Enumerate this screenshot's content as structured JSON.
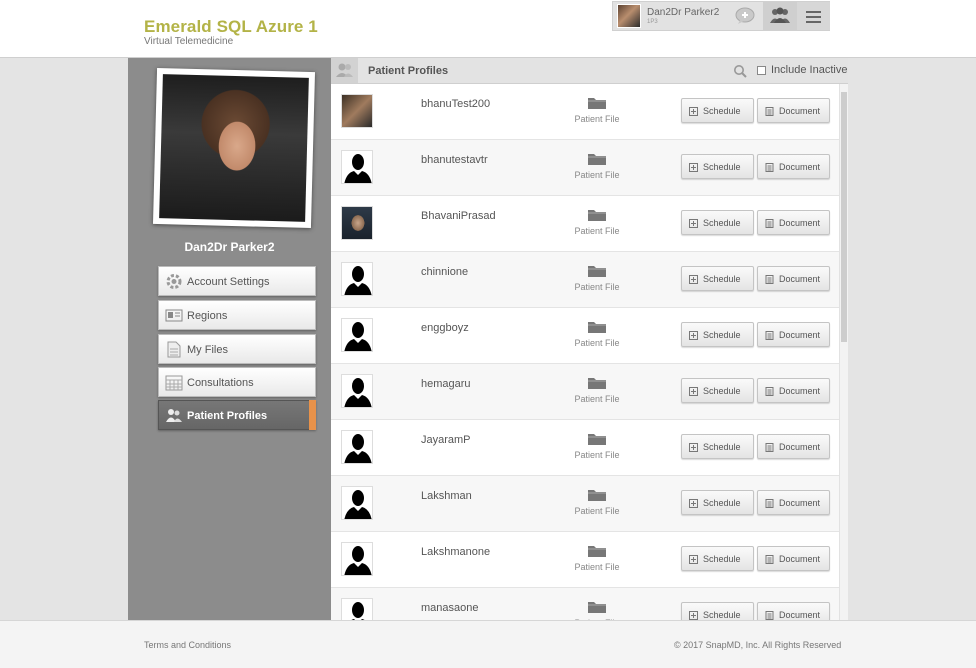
{
  "header": {
    "title": "Emerald SQL Azure 1",
    "subtitle": "Virtual Telemedicine",
    "user": {
      "name": "Dan2Dr Parker2",
      "sub": "1P3"
    }
  },
  "sidebar": {
    "profile_name": "Dan2Dr Parker2",
    "items": [
      {
        "label": "Account Settings",
        "icon": "gear-icon"
      },
      {
        "label": "Regions",
        "icon": "id-card-icon"
      },
      {
        "label": "My Files",
        "icon": "document-icon"
      },
      {
        "label": "Consultations",
        "icon": "calendar-icon"
      },
      {
        "label": "Patient Profiles",
        "icon": "people-icon",
        "active": true
      }
    ]
  },
  "panel": {
    "title": "Patient Profiles",
    "include_inactive_label": "Include Inactive",
    "include_inactive_checked": false
  },
  "patients": [
    {
      "name": "bhanuTest200",
      "avatar": "photo"
    },
    {
      "name": "bhanutestavtr",
      "avatar": "silhouette"
    },
    {
      "name": "BhavaniPrasad",
      "avatar": "photo"
    },
    {
      "name": "chinnione",
      "avatar": "silhouette"
    },
    {
      "name": "enggboyz",
      "avatar": "silhouette"
    },
    {
      "name": "hemagaru",
      "avatar": "silhouette"
    },
    {
      "name": "JayaramP",
      "avatar": "silhouette"
    },
    {
      "name": "Lakshman",
      "avatar": "silhouette"
    },
    {
      "name": "Lakshmanone",
      "avatar": "silhouette"
    },
    {
      "name": "manasaone",
      "avatar": "silhouette"
    }
  ],
  "row_labels": {
    "patient_file": "Patient File",
    "schedule": "Schedule",
    "document": "Document"
  },
  "footer": {
    "terms": "Terms and Conditions",
    "copyright": "© 2017 SnapMD, Inc. All Rights Reserved"
  },
  "colors": {
    "brand": "#b3b347",
    "accent": "#e8924a",
    "sidebar": "#8c8c8c"
  }
}
